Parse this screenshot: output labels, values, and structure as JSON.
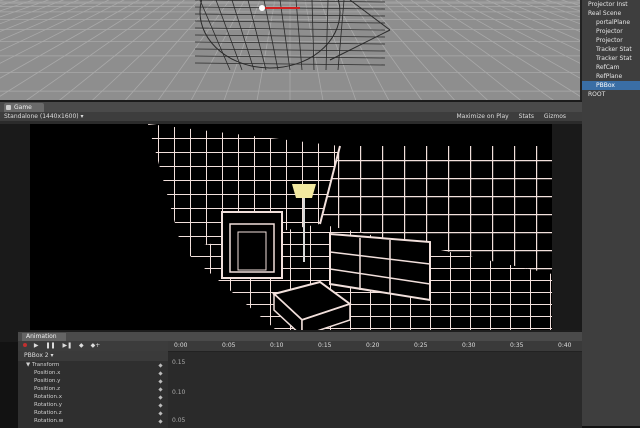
{
  "scene": {},
  "hierarchy": {
    "items": [
      {
        "label": "Projector Inst",
        "indent": false,
        "selected": false
      },
      {
        "label": "Real Scene",
        "indent": false,
        "selected": false
      },
      {
        "label": "portalPlane",
        "indent": true,
        "selected": false
      },
      {
        "label": "Projector",
        "indent": true,
        "selected": false
      },
      {
        "label": "Projector",
        "indent": true,
        "selected": false
      },
      {
        "label": "Tracker Stat",
        "indent": true,
        "selected": false
      },
      {
        "label": "Tracker Stat",
        "indent": true,
        "selected": false
      },
      {
        "label": "RefCam",
        "indent": true,
        "selected": false
      },
      {
        "label": "RefPlane",
        "indent": true,
        "selected": false
      },
      {
        "label": "PBBox",
        "indent": true,
        "selected": true
      },
      {
        "label": "ROOT",
        "indent": false,
        "selected": false
      }
    ]
  },
  "game": {
    "tab_label": "Game",
    "resolution": "Standalone (1440x1600)",
    "options": [
      "Maximize on Play",
      "Stats",
      "Gizmos"
    ]
  },
  "animation": {
    "tab_label": "Animation",
    "controls": [
      "▶",
      "❚❚",
      "▶❚",
      "◆",
      "◆+"
    ],
    "clip": "PBBox 2",
    "properties": [
      {
        "label": "▼ Transform",
        "parent": true
      },
      {
        "label": "Position.x",
        "parent": false
      },
      {
        "label": "Position.y",
        "parent": false
      },
      {
        "label": "Position.z",
        "parent": false
      },
      {
        "label": "Rotation.x",
        "parent": false
      },
      {
        "label": "Rotation.y",
        "parent": false
      },
      {
        "label": "Rotation.z",
        "parent": false
      },
      {
        "label": "Rotation.w",
        "parent": false
      }
    ],
    "ruler": [
      "0:00",
      "0:05",
      "0:10",
      "0:15",
      "0:20",
      "0:25",
      "0:30",
      "0:35",
      "0:40"
    ],
    "values": [
      "0.15",
      "0.10",
      "0.05"
    ]
  }
}
